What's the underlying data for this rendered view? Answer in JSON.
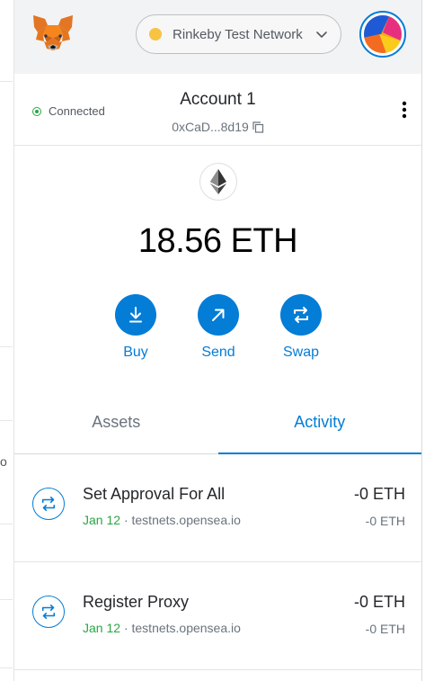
{
  "header": {
    "network": {
      "label": "Rinkeby Test Network",
      "dot_color": "#f6c343"
    },
    "brand_color": "#037dd6"
  },
  "account": {
    "status": "Connected",
    "name": "Account 1",
    "address": "0xCaD...8d19"
  },
  "wallet": {
    "balance": "18.56 ETH",
    "actions": [
      {
        "label": "Buy",
        "icon": "download-arrow-icon"
      },
      {
        "label": "Send",
        "icon": "arrow-up-right-icon"
      },
      {
        "label": "Swap",
        "icon": "swap-arrows-icon"
      }
    ]
  },
  "tabs": [
    {
      "label": "Assets",
      "active": false
    },
    {
      "label": "Activity",
      "active": true
    }
  ],
  "activity": [
    {
      "title": "Set Approval For All",
      "date": "Jan 12",
      "origin": "testnets.opensea.io",
      "amount": "-0 ETH",
      "fiat": "-0 ETH"
    },
    {
      "title": "Register Proxy",
      "date": "Jan 12",
      "origin": "testnets.opensea.io",
      "amount": "-0 ETH",
      "fiat": "-0 ETH"
    }
  ],
  "background": {
    "partial_text": "o"
  }
}
